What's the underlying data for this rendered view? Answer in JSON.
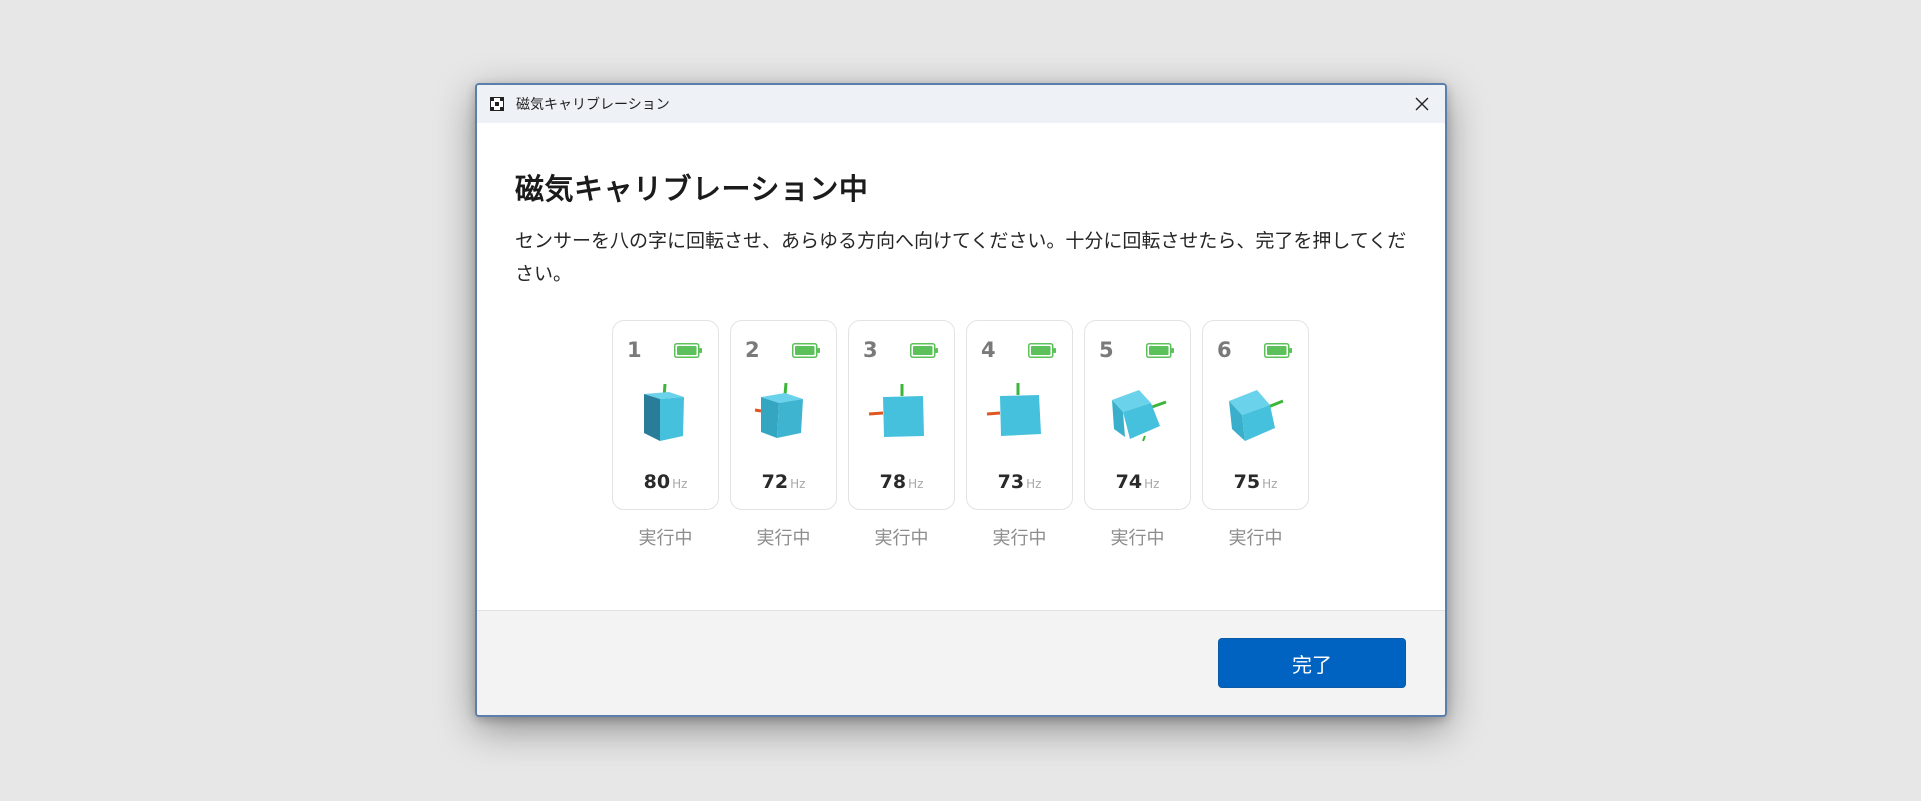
{
  "window": {
    "title": "磁気キャリブレーション",
    "app_icon": "checker-app-icon",
    "close_icon": "close-icon"
  },
  "main": {
    "heading": "磁気キャリブレーション中",
    "description": "センサーを八の字に回転させ、あらゆる方向へ向けてください。十分に回転させたら、完了を押してください。"
  },
  "sensors": [
    {
      "number": "1",
      "rate": "80",
      "unit": "Hz",
      "status": "実行中",
      "battery": "full"
    },
    {
      "number": "2",
      "rate": "72",
      "unit": "Hz",
      "status": "実行中",
      "battery": "full"
    },
    {
      "number": "3",
      "rate": "78",
      "unit": "Hz",
      "status": "実行中",
      "battery": "full"
    },
    {
      "number": "4",
      "rate": "73",
      "unit": "Hz",
      "status": "実行中",
      "battery": "full"
    },
    {
      "number": "5",
      "rate": "74",
      "unit": "Hz",
      "status": "実行中",
      "battery": "full"
    },
    {
      "number": "6",
      "rate": "75",
      "unit": "Hz",
      "status": "実行中",
      "battery": "full"
    }
  ],
  "footer": {
    "done_label": "完了"
  },
  "colors": {
    "accent": "#0063c1",
    "battery": "#5cc15a",
    "cube": "#45c1dd",
    "axis_y": "#3cb53a",
    "axis_x": "#e0561f"
  }
}
